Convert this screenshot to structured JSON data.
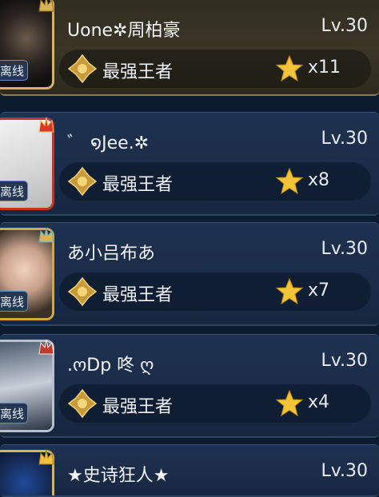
{
  "players": [
    {
      "name": "Uone✲周柏豪",
      "level": "Lv.30",
      "rank": "最强王者",
      "stars": "x11",
      "avatar_tag": "离线"
    },
    {
      "name": "゛ ໑Jee.✲",
      "level": "Lv.30",
      "rank": "最强王者",
      "stars": "x8",
      "avatar_tag": "离线"
    },
    {
      "name": "あ小吕布あ",
      "level": "Lv.30",
      "rank": "最强王者",
      "stars": "x7",
      "avatar_tag": "离线"
    },
    {
      "name": ".ოDp 咚 ღ",
      "level": "Lv.30",
      "rank": "最强王者",
      "stars": "x4",
      "avatar_tag": "离线"
    },
    {
      "name": "★史诗狂人★",
      "level": "Lv.30"
    }
  ],
  "colors": {
    "gold": "#c9a24a",
    "star": "#f3c33a",
    "row_bg": "#1e3150",
    "first_row_bg": "#2f2c20"
  },
  "icons": {
    "rank": "king-rank-emblem-icon",
    "star": "star-icon",
    "frame": "crown-frame-icon"
  }
}
